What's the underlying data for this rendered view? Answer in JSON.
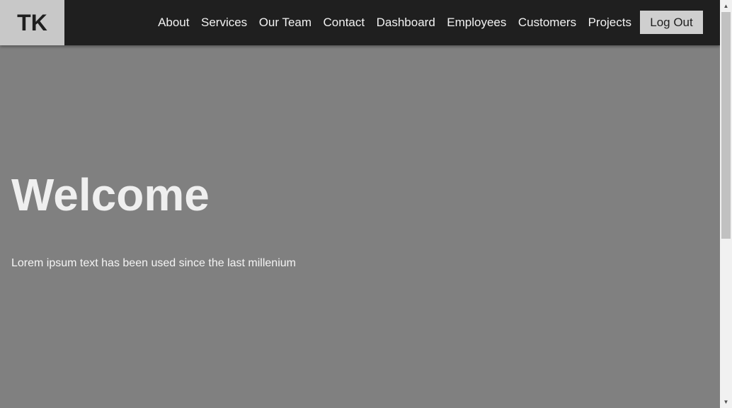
{
  "header": {
    "logo_text": "TK",
    "nav_items": [
      "About",
      "Services",
      "Our Team",
      "Contact",
      "Dashboard",
      "Employees",
      "Customers",
      "Projects"
    ],
    "logout_label": "Log Out"
  },
  "hero": {
    "title": "Welcome",
    "text": "Lorem ipsum text has been used since the last millenium"
  },
  "scrollbar": {
    "up_icon": "triangle-up",
    "down_icon": "triangle-down"
  },
  "colors": {
    "navbar_bg": "#1f1f1f",
    "logo_bg": "#c8c8c8",
    "page_bg": "#808080",
    "button_bg": "#cfcfcf"
  }
}
